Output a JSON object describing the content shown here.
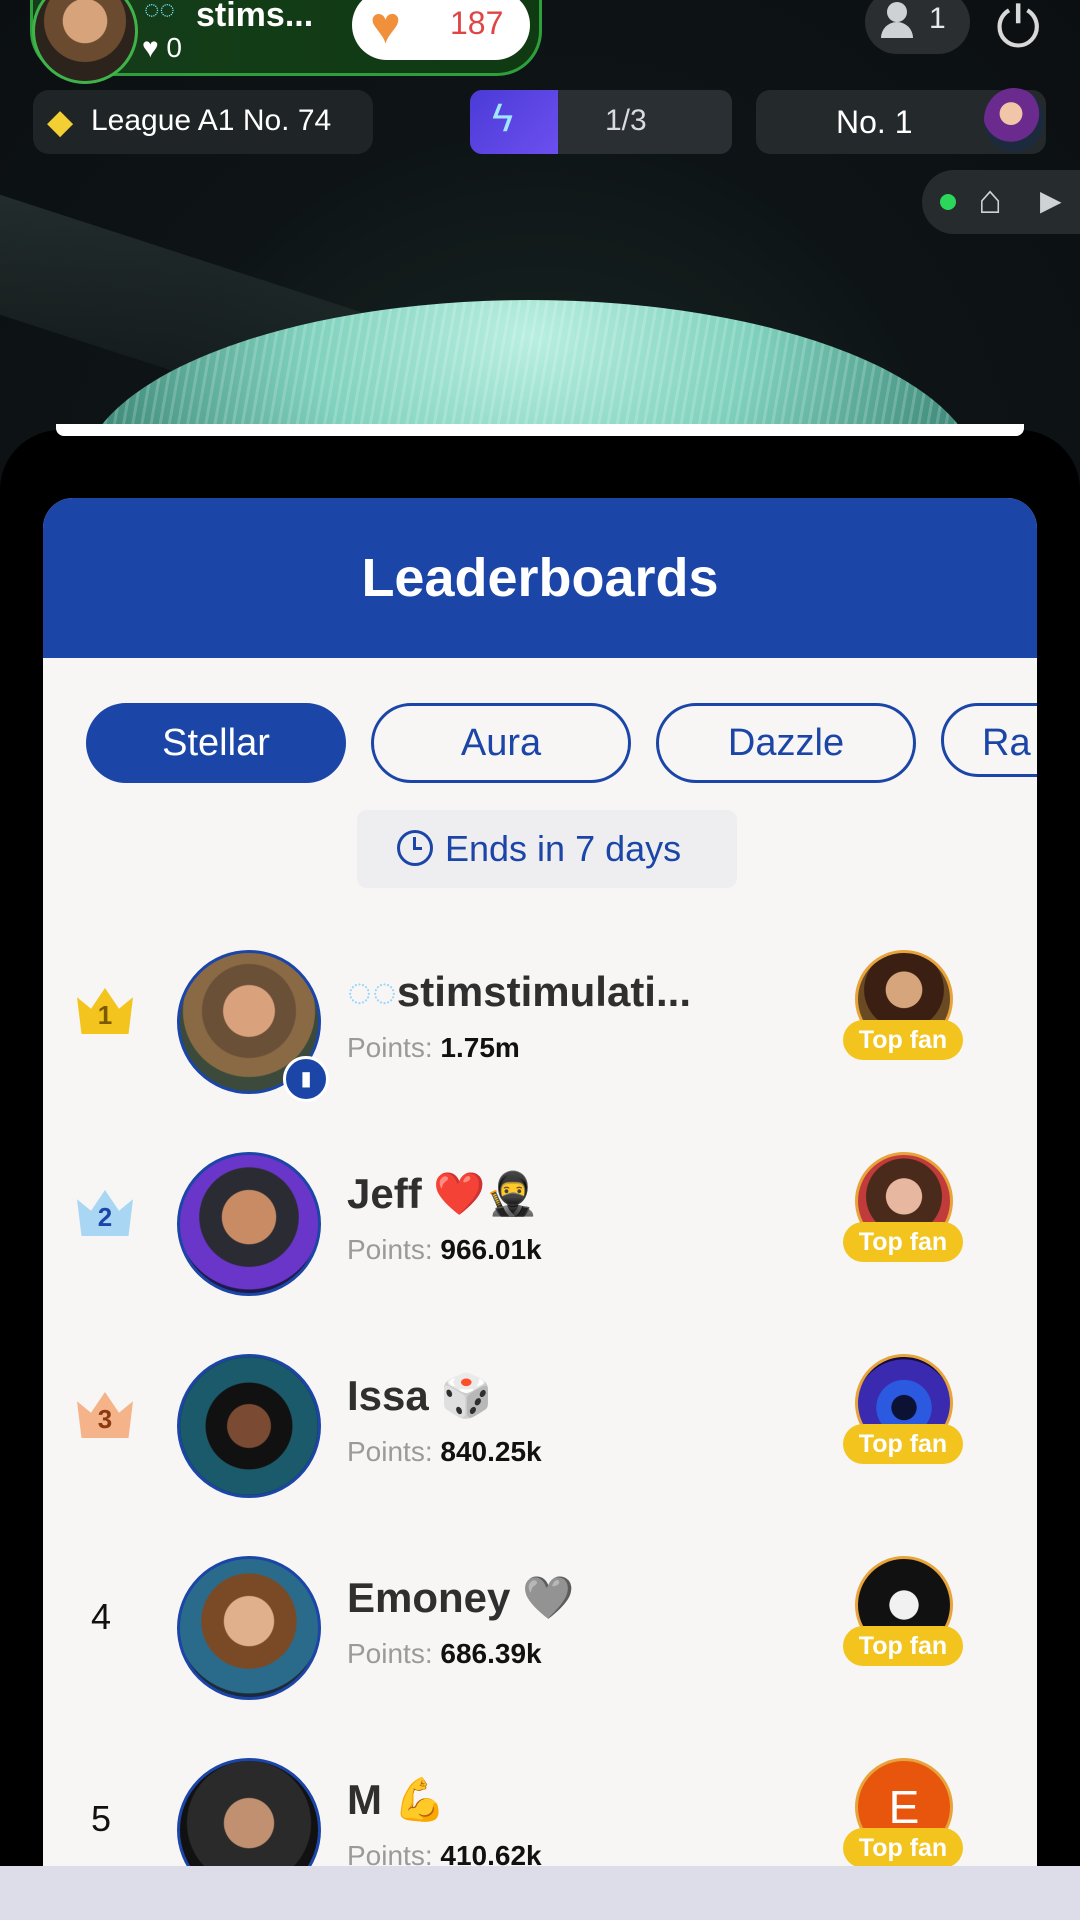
{
  "stream": {
    "host_name": "stims...",
    "host_bubbles": "◌◌",
    "host_likes": "0",
    "like_count": "187",
    "viewer_count": "1",
    "league": "League A1 No. 74",
    "match_progress": "1/3",
    "rank_label": "No. 1",
    "live_status_color": "#2bd65a"
  },
  "leaderboard": {
    "title": "Leaderboards",
    "tabs": [
      "Stellar",
      "Aura",
      "Dazzle",
      "Ra"
    ],
    "active_tab": "Stellar",
    "ends_text": "Ends in 7 days",
    "points_label": "Points:",
    "top_fan_label": "Top fan",
    "rows": [
      {
        "rank": "1",
        "name": "stimstimulati...",
        "name_prefix": "◌◌",
        "points": "1.75m",
        "crown_color": "#f2c41d"
      },
      {
        "rank": "2",
        "name": "Jeff ❤️🥷",
        "points": "966.01k",
        "crown_color": "#a9d7f3"
      },
      {
        "rank": "3",
        "name": "Issa 🎲",
        "points": "840.25k",
        "crown_color": "#f5b38a"
      },
      {
        "rank": "4",
        "name": "Emoney 🩶",
        "points": "686.39k"
      },
      {
        "rank": "5",
        "name": "M 💪",
        "points": "410.62k",
        "fan_initial": "E"
      }
    ]
  },
  "colors": {
    "brand_blue": "#1b46a8",
    "top_fan_yellow": "#f2c41d",
    "host_green": "#2ea03b"
  }
}
